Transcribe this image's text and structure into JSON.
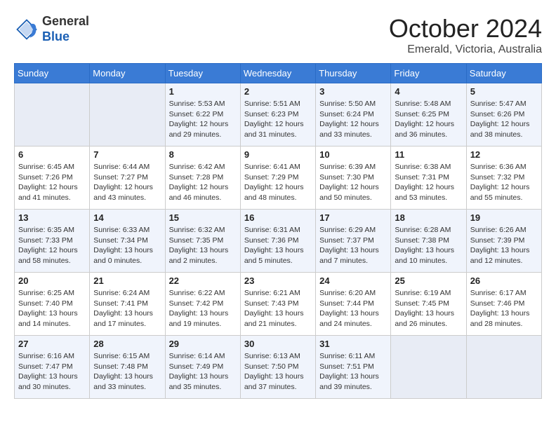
{
  "logo": {
    "general": "General",
    "blue": "Blue"
  },
  "header": {
    "month": "October 2024",
    "location": "Emerald, Victoria, Australia"
  },
  "weekdays": [
    "Sunday",
    "Monday",
    "Tuesday",
    "Wednesday",
    "Thursday",
    "Friday",
    "Saturday"
  ],
  "weeks": [
    [
      {
        "day": "",
        "empty": true
      },
      {
        "day": "",
        "empty": true
      },
      {
        "day": "1",
        "sunrise": "Sunrise: 5:53 AM",
        "sunset": "Sunset: 6:22 PM",
        "daylight": "Daylight: 12 hours and 29 minutes."
      },
      {
        "day": "2",
        "sunrise": "Sunrise: 5:51 AM",
        "sunset": "Sunset: 6:23 PM",
        "daylight": "Daylight: 12 hours and 31 minutes."
      },
      {
        "day": "3",
        "sunrise": "Sunrise: 5:50 AM",
        "sunset": "Sunset: 6:24 PM",
        "daylight": "Daylight: 12 hours and 33 minutes."
      },
      {
        "day": "4",
        "sunrise": "Sunrise: 5:48 AM",
        "sunset": "Sunset: 6:25 PM",
        "daylight": "Daylight: 12 hours and 36 minutes."
      },
      {
        "day": "5",
        "sunrise": "Sunrise: 5:47 AM",
        "sunset": "Sunset: 6:26 PM",
        "daylight": "Daylight: 12 hours and 38 minutes."
      }
    ],
    [
      {
        "day": "6",
        "sunrise": "Sunrise: 6:45 AM",
        "sunset": "Sunset: 7:26 PM",
        "daylight": "Daylight: 12 hours and 41 minutes."
      },
      {
        "day": "7",
        "sunrise": "Sunrise: 6:44 AM",
        "sunset": "Sunset: 7:27 PM",
        "daylight": "Daylight: 12 hours and 43 minutes."
      },
      {
        "day": "8",
        "sunrise": "Sunrise: 6:42 AM",
        "sunset": "Sunset: 7:28 PM",
        "daylight": "Daylight: 12 hours and 46 minutes."
      },
      {
        "day": "9",
        "sunrise": "Sunrise: 6:41 AM",
        "sunset": "Sunset: 7:29 PM",
        "daylight": "Daylight: 12 hours and 48 minutes."
      },
      {
        "day": "10",
        "sunrise": "Sunrise: 6:39 AM",
        "sunset": "Sunset: 7:30 PM",
        "daylight": "Daylight: 12 hours and 50 minutes."
      },
      {
        "day": "11",
        "sunrise": "Sunrise: 6:38 AM",
        "sunset": "Sunset: 7:31 PM",
        "daylight": "Daylight: 12 hours and 53 minutes."
      },
      {
        "day": "12",
        "sunrise": "Sunrise: 6:36 AM",
        "sunset": "Sunset: 7:32 PM",
        "daylight": "Daylight: 12 hours and 55 minutes."
      }
    ],
    [
      {
        "day": "13",
        "sunrise": "Sunrise: 6:35 AM",
        "sunset": "Sunset: 7:33 PM",
        "daylight": "Daylight: 12 hours and 58 minutes."
      },
      {
        "day": "14",
        "sunrise": "Sunrise: 6:33 AM",
        "sunset": "Sunset: 7:34 PM",
        "daylight": "Daylight: 13 hours and 0 minutes."
      },
      {
        "day": "15",
        "sunrise": "Sunrise: 6:32 AM",
        "sunset": "Sunset: 7:35 PM",
        "daylight": "Daylight: 13 hours and 2 minutes."
      },
      {
        "day": "16",
        "sunrise": "Sunrise: 6:31 AM",
        "sunset": "Sunset: 7:36 PM",
        "daylight": "Daylight: 13 hours and 5 minutes."
      },
      {
        "day": "17",
        "sunrise": "Sunrise: 6:29 AM",
        "sunset": "Sunset: 7:37 PM",
        "daylight": "Daylight: 13 hours and 7 minutes."
      },
      {
        "day": "18",
        "sunrise": "Sunrise: 6:28 AM",
        "sunset": "Sunset: 7:38 PM",
        "daylight": "Daylight: 13 hours and 10 minutes."
      },
      {
        "day": "19",
        "sunrise": "Sunrise: 6:26 AM",
        "sunset": "Sunset: 7:39 PM",
        "daylight": "Daylight: 13 hours and 12 minutes."
      }
    ],
    [
      {
        "day": "20",
        "sunrise": "Sunrise: 6:25 AM",
        "sunset": "Sunset: 7:40 PM",
        "daylight": "Daylight: 13 hours and 14 minutes."
      },
      {
        "day": "21",
        "sunrise": "Sunrise: 6:24 AM",
        "sunset": "Sunset: 7:41 PM",
        "daylight": "Daylight: 13 hours and 17 minutes."
      },
      {
        "day": "22",
        "sunrise": "Sunrise: 6:22 AM",
        "sunset": "Sunset: 7:42 PM",
        "daylight": "Daylight: 13 hours and 19 minutes."
      },
      {
        "day": "23",
        "sunrise": "Sunrise: 6:21 AM",
        "sunset": "Sunset: 7:43 PM",
        "daylight": "Daylight: 13 hours and 21 minutes."
      },
      {
        "day": "24",
        "sunrise": "Sunrise: 6:20 AM",
        "sunset": "Sunset: 7:44 PM",
        "daylight": "Daylight: 13 hours and 24 minutes."
      },
      {
        "day": "25",
        "sunrise": "Sunrise: 6:19 AM",
        "sunset": "Sunset: 7:45 PM",
        "daylight": "Daylight: 13 hours and 26 minutes."
      },
      {
        "day": "26",
        "sunrise": "Sunrise: 6:17 AM",
        "sunset": "Sunset: 7:46 PM",
        "daylight": "Daylight: 13 hours and 28 minutes."
      }
    ],
    [
      {
        "day": "27",
        "sunrise": "Sunrise: 6:16 AM",
        "sunset": "Sunset: 7:47 PM",
        "daylight": "Daylight: 13 hours and 30 minutes."
      },
      {
        "day": "28",
        "sunrise": "Sunrise: 6:15 AM",
        "sunset": "Sunset: 7:48 PM",
        "daylight": "Daylight: 13 hours and 33 minutes."
      },
      {
        "day": "29",
        "sunrise": "Sunrise: 6:14 AM",
        "sunset": "Sunset: 7:49 PM",
        "daylight": "Daylight: 13 hours and 35 minutes."
      },
      {
        "day": "30",
        "sunrise": "Sunrise: 6:13 AM",
        "sunset": "Sunset: 7:50 PM",
        "daylight": "Daylight: 13 hours and 37 minutes."
      },
      {
        "day": "31",
        "sunrise": "Sunrise: 6:11 AM",
        "sunset": "Sunset: 7:51 PM",
        "daylight": "Daylight: 13 hours and 39 minutes."
      },
      {
        "day": "",
        "empty": true
      },
      {
        "day": "",
        "empty": true
      }
    ]
  ]
}
